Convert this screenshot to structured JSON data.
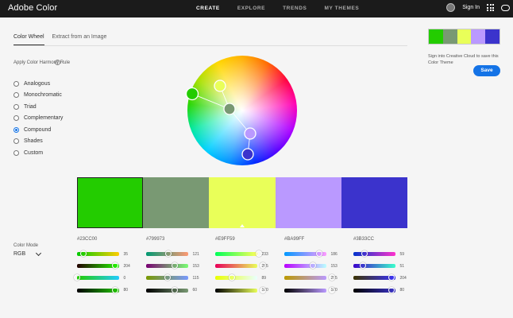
{
  "app": {
    "title": "Adobe Color"
  },
  "nav": {
    "items": [
      "CREATE",
      "EXPLORE",
      "TRENDS",
      "MY THEMES"
    ],
    "active": 0
  },
  "header": {
    "sign_in": "Sign In",
    "icons": [
      "theme-circle-icon",
      "apps-grid-icon",
      "creative-cloud-icon"
    ]
  },
  "tabs": [
    {
      "label": "Color Wheel",
      "active": true
    },
    {
      "label": "Extract from an Image",
      "active": false
    }
  ],
  "harmony": {
    "title": "Apply Color Harmony Rule",
    "rules": [
      "Analogous",
      "Monochromatic",
      "Triad",
      "Complementary",
      "Compound",
      "Shades",
      "Custom"
    ],
    "selected": "Compound"
  },
  "swatches": [
    {
      "hex": "#23CC00",
      "color": "#23CC00",
      "base": true
    },
    {
      "hex": "#799973",
      "color": "#799973",
      "base": false
    },
    {
      "hex": "#E9FF59",
      "color": "#E9FF59",
      "base": false
    },
    {
      "hex": "#BA99FF",
      "color": "#BA99FF",
      "base": false
    },
    {
      "hex": "#3B33CC",
      "color": "#3B33CC",
      "base": false
    }
  ],
  "color_mode": {
    "label": "Color Mode",
    "value": "RGB"
  },
  "sliders": [
    [
      {
        "value": "35",
        "frac": 0.14
      },
      {
        "value": "204",
        "frac": 0.8
      },
      {
        "value": "0",
        "frac": 0.0
      },
      {
        "value": "80",
        "frac": 0.8
      }
    ],
    [
      {
        "value": "121",
        "frac": 0.47
      },
      {
        "value": "153",
        "frac": 0.6
      },
      {
        "value": "115",
        "frac": 0.45
      },
      {
        "value": "60",
        "frac": 0.6
      }
    ],
    [
      {
        "value": "233",
        "frac": 0.91
      },
      {
        "value": "255",
        "frac": 1.0
      },
      {
        "value": "89",
        "frac": 0.35
      },
      {
        "value": "100",
        "frac": 1.0
      }
    ],
    [
      {
        "value": "186",
        "frac": 0.73
      },
      {
        "value": "153",
        "frac": 0.6
      },
      {
        "value": "255",
        "frac": 1.0
      },
      {
        "value": "100",
        "frac": 1.0
      }
    ],
    [
      {
        "value": "59",
        "frac": 0.23
      },
      {
        "value": "51",
        "frac": 0.2
      },
      {
        "value": "204",
        "frac": 0.8
      },
      {
        "value": "80",
        "frac": 0.8
      }
    ]
  ],
  "theme_panel": {
    "message": "Sign into Creative Cloud to save this Color Theme",
    "save_label": "Save"
  }
}
